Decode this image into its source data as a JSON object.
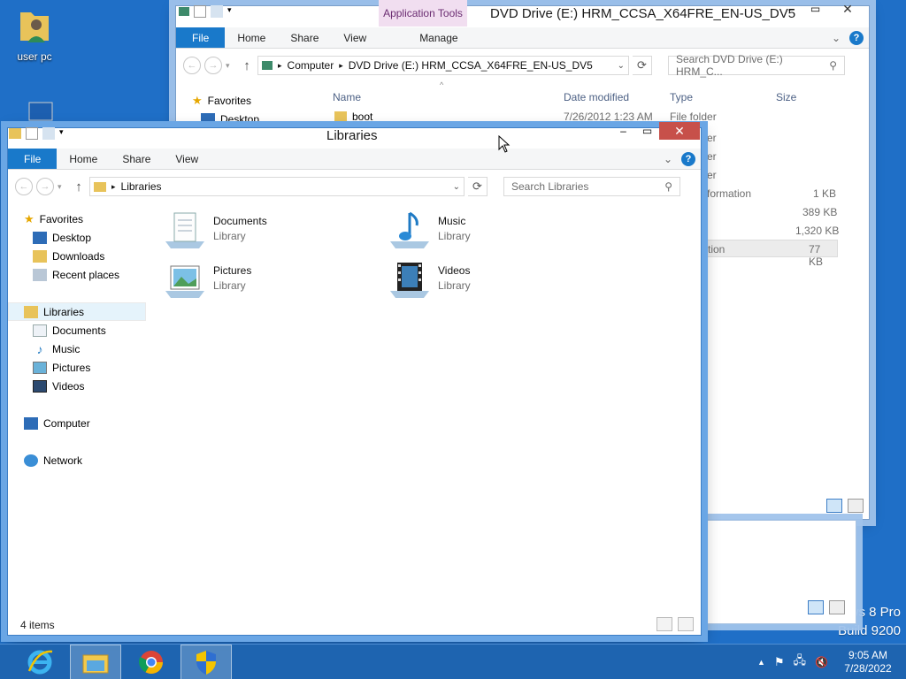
{
  "desktop": {
    "icon_user_label": "user pc",
    "watermark_line1": "ws 8 Pro",
    "watermark_line2": "Build 9200"
  },
  "dvd_window": {
    "title": "DVD Drive (E:) HRM_CCSA_X64FRE_EN-US_DV5",
    "context_tab": "Application Tools",
    "tabs": {
      "file": "File",
      "home": "Home",
      "share": "Share",
      "view": "View",
      "manage": "Manage"
    },
    "address": {
      "part1": "Computer",
      "part2": "DVD Drive (E:) HRM_CCSA_X64FRE_EN-US_DV5"
    },
    "search_placeholder": "Search DVD Drive (E:) HRM_C...",
    "columns": {
      "name": "Name",
      "date": "Date modified",
      "type": "Type",
      "size": "Size"
    },
    "nav": {
      "favorites": "Favorites",
      "desktop": "Desktop"
    },
    "rows": [
      {
        "name": "boot",
        "date": "7/26/2012 1:23 AM",
        "type": "File folder",
        "size": ""
      }
    ],
    "partial_types": [
      "er",
      "er",
      "er",
      "formation",
      "",
      "",
      "tion"
    ],
    "partial_sizes": [
      "",
      "",
      "",
      "1 KB",
      "389 KB",
      "1,320 KB",
      "77 KB"
    ]
  },
  "lib_window": {
    "title": "Libraries",
    "tabs": {
      "file": "File",
      "home": "Home",
      "share": "Share",
      "view": "View"
    },
    "address": "Libraries",
    "search_placeholder": "Search Libraries",
    "nav": {
      "favorites": "Favorites",
      "desktop": "Desktop",
      "downloads": "Downloads",
      "recent": "Recent places",
      "libraries": "Libraries",
      "documents": "Documents",
      "music": "Music",
      "pictures": "Pictures",
      "videos": "Videos",
      "computer": "Computer",
      "network": "Network"
    },
    "items": [
      {
        "name": "Documents",
        "kind": "Library"
      },
      {
        "name": "Music",
        "kind": "Library"
      },
      {
        "name": "Pictures",
        "kind": "Library"
      },
      {
        "name": "Videos",
        "kind": "Library"
      }
    ],
    "status": "4 items"
  },
  "taskbar": {
    "time": "9:05 AM",
    "date": "7/28/2022"
  },
  "colors": {
    "accent": "#1979ca",
    "close": "#c7504a",
    "taskbar": "#1e64af"
  }
}
